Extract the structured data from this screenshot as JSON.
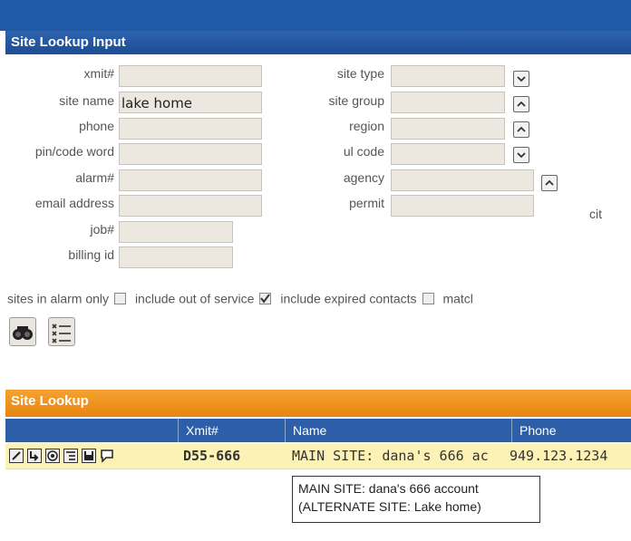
{
  "section_title": "Site Lookup Input",
  "fields_left": [
    {
      "label": "xmit#",
      "value": ""
    },
    {
      "label": "site name",
      "value": "lake home"
    },
    {
      "label": "phone",
      "value": ""
    },
    {
      "label": "pin/code word",
      "value": ""
    },
    {
      "label": "alarm#",
      "value": ""
    },
    {
      "label": "email address",
      "value": ""
    },
    {
      "label": "job#",
      "value": ""
    },
    {
      "label": "billing id",
      "value": ""
    }
  ],
  "fields_right": [
    {
      "label": "site type",
      "value": "",
      "dropdown": "down"
    },
    {
      "label": "site group",
      "value": "",
      "dropdown": "up"
    },
    {
      "label": "region",
      "value": "",
      "dropdown": "up"
    },
    {
      "label": "ul code",
      "value": "",
      "dropdown": "down"
    },
    {
      "label": "agency",
      "value": "",
      "dropdown": "up"
    },
    {
      "label": "permit",
      "value": ""
    }
  ],
  "cut_label": "cit",
  "options": [
    {
      "label": "sites in alarm only",
      "checked": false
    },
    {
      "label": "include out of service",
      "checked": true
    },
    {
      "label": "include expired contacts",
      "checked": false
    },
    {
      "label": "matcl",
      "checked": false
    }
  ],
  "toolbar_icons": [
    "binoculars-icon",
    "checklist-icon"
  ],
  "results_title": "Site Lookup",
  "columns": [
    "Xmit#",
    "Name",
    "Phone"
  ],
  "rows": [
    {
      "xmit": "D55-666",
      "name": "MAIN SITE: dana's 666 ac",
      "phone": "949.123.1234"
    }
  ],
  "row_icons": [
    "edit-icon",
    "forward-icon",
    "dial-icon",
    "list-icon",
    "save-icon",
    "comment-icon"
  ],
  "tooltip": {
    "line1": "MAIN SITE: dana's 666 account",
    "line2": "(ALTERNATE SITE: Lake home)"
  },
  "colors": {
    "header_blue": "#1f5aa6",
    "results_orange": "#f29a25",
    "row_highlight": "#fdf2b6"
  }
}
